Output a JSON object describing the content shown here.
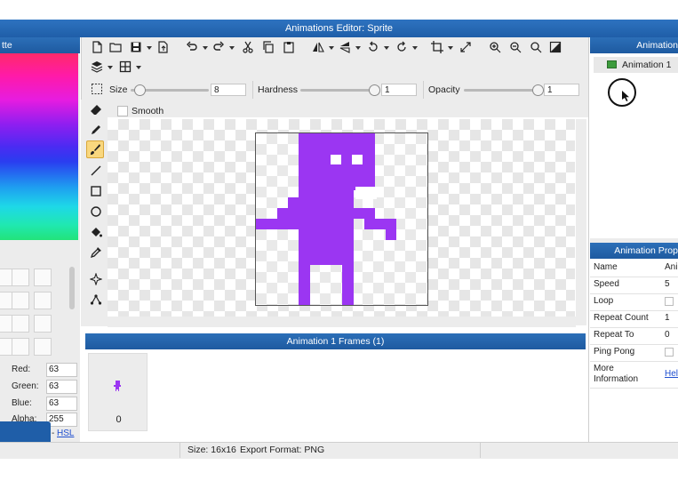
{
  "window": {
    "title": "Animations Editor: Sprite"
  },
  "palette": {
    "title_fragment": "tte",
    "red_label": "Red:",
    "red_value": "63",
    "green_label": "Green:",
    "green_value": "63",
    "blue_label": "Blue:",
    "blue_value": "63",
    "alpha_label": "Alpha:",
    "alpha_value": "255",
    "hsl_link": "HSL",
    "current_color": "#1f5ea8"
  },
  "toolbar": {
    "size_label": "Size",
    "size_value": "8",
    "size_level": 0.05,
    "hardness_label": "Hardness",
    "hardness_value": "1",
    "hardness_level": 1.0,
    "opacity_label": "Opacity",
    "opacity_value": "1",
    "opacity_level": 1.0,
    "smooth_label": "Smooth"
  },
  "animations_panel": {
    "title_fragment": "Animation",
    "items": [
      {
        "label": "Animation 1"
      }
    ]
  },
  "frames_panel": {
    "title": "Animation 1 Frames (1)",
    "frames": [
      {
        "index": "0"
      }
    ]
  },
  "properties_panel": {
    "title_fragment": "Animation Prop",
    "rows": [
      {
        "key": "Name",
        "value": "Ani"
      },
      {
        "key": "Speed",
        "value": "5"
      },
      {
        "key": "Loop",
        "value": ""
      },
      {
        "key": "Repeat Count",
        "value": "1"
      },
      {
        "key": "Repeat To",
        "value": "0"
      },
      {
        "key": "Ping Pong",
        "value": ""
      },
      {
        "key": "More Information",
        "value": "Hel"
      }
    ]
  },
  "status": {
    "size": "Size: 16x16",
    "export_format": "Export Format: PNG"
  },
  "sprite": {
    "color": "#9b36f2"
  }
}
